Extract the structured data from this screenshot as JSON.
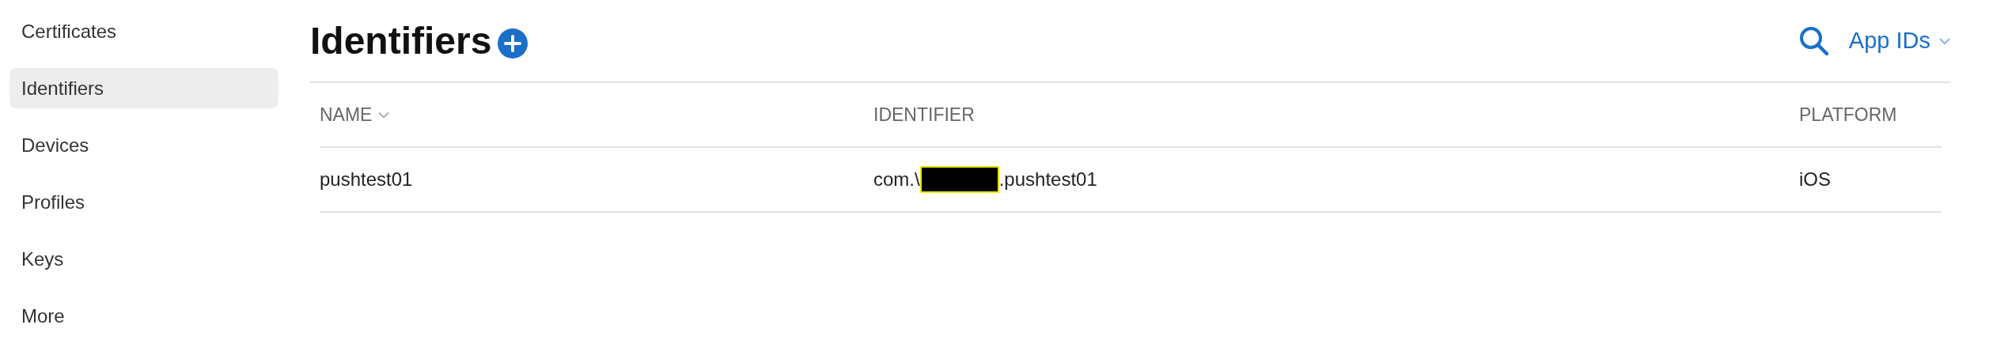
{
  "sidebar": {
    "items": [
      {
        "label": "Certificates",
        "selected": false
      },
      {
        "label": "Identifiers",
        "selected": true
      },
      {
        "label": "Devices",
        "selected": false
      },
      {
        "label": "Profiles",
        "selected": false
      },
      {
        "label": "Keys",
        "selected": false
      },
      {
        "label": "More",
        "selected": false
      }
    ]
  },
  "page_title": "Identifiers",
  "filter": {
    "label": "App IDs"
  },
  "table": {
    "columns": [
      {
        "label": "NAME",
        "sortable": true
      },
      {
        "label": "IDENTIFIER",
        "sortable": false
      },
      {
        "label": "PLATFORM",
        "sortable": false
      }
    ],
    "rows": [
      {
        "name": "pushtest01",
        "identifier_prefix": "com.\\",
        "identifier_redacted": true,
        "identifier_suffix": ".pushtest01",
        "platform": "iOS"
      }
    ]
  }
}
